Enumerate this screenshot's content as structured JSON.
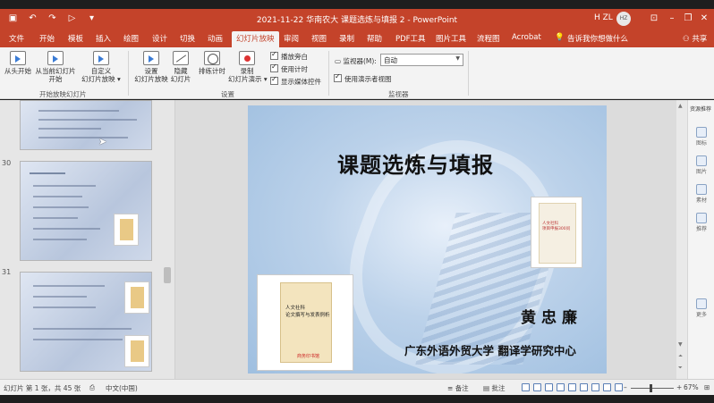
{
  "window": {
    "title": "2021-11-22 华南农大   课题选炼与填报 2  -  PowerPoint",
    "user": "H ZL",
    "avatar_initials": "HZ",
    "qat": [
      "save-icon",
      "undo-icon",
      "redo-icon",
      "start-from-beginning-icon",
      "customize-qat-icon"
    ]
  },
  "tabs": [
    "文件",
    "开始",
    "模板",
    "插入",
    "绘图",
    "设计",
    "切换",
    "动画",
    "幻灯片放映",
    "审阅",
    "视图",
    "录制",
    "帮助",
    "PDF工具",
    "图片工具",
    "流程图",
    "Acrobat"
  ],
  "active_tab": "幻灯片放映",
  "tell_me": "告诉我你想做什么",
  "share": "共享",
  "ribbon": {
    "from_beginning": "从头开始",
    "from_current_1": "从当前幻灯片",
    "from_current_2": "开始",
    "custom_show_1": "自定义",
    "custom_show_2": "幻灯片放映",
    "group_start": "开始放映幻灯片",
    "setup_1": "设置",
    "setup_2": "幻灯片放映",
    "hide_1": "隐藏",
    "hide_2": "幻灯片",
    "rehearse": "排练计时",
    "record_1": "录制",
    "record_2": "幻灯片演示",
    "play_narrations": "播放旁白",
    "use_timings": "使用计时",
    "show_media_controls": "显示媒体控件",
    "group_setup": "设置",
    "monitor_label": "监视器(M):",
    "monitor_value": "自动",
    "presenter_view": "使用演示者视图",
    "group_monitors": "监视器"
  },
  "thumbnails": {
    "slide_numbers": [
      "30",
      "31"
    ]
  },
  "slide": {
    "title": "课题选炼与填报",
    "author": "黄忠廉",
    "organization": "广东外语外贸大学  翻译学研究中心",
    "book_small": "人文社科\n项目申报300问",
    "book_large_1": "人文社科",
    "book_large_2": "论文撰写与发表例析",
    "book_large_pub": "商务印书馆"
  },
  "right_pane": {
    "title": "资源推荐",
    "items": [
      "图标",
      "图片",
      "素材",
      "推荐",
      "更多"
    ]
  },
  "status": {
    "slide_info": "幻灯片 第 1 张，共 45 张",
    "language": "中文(中国)",
    "notes": "备注",
    "comments": "批注",
    "zoom": "67%"
  }
}
